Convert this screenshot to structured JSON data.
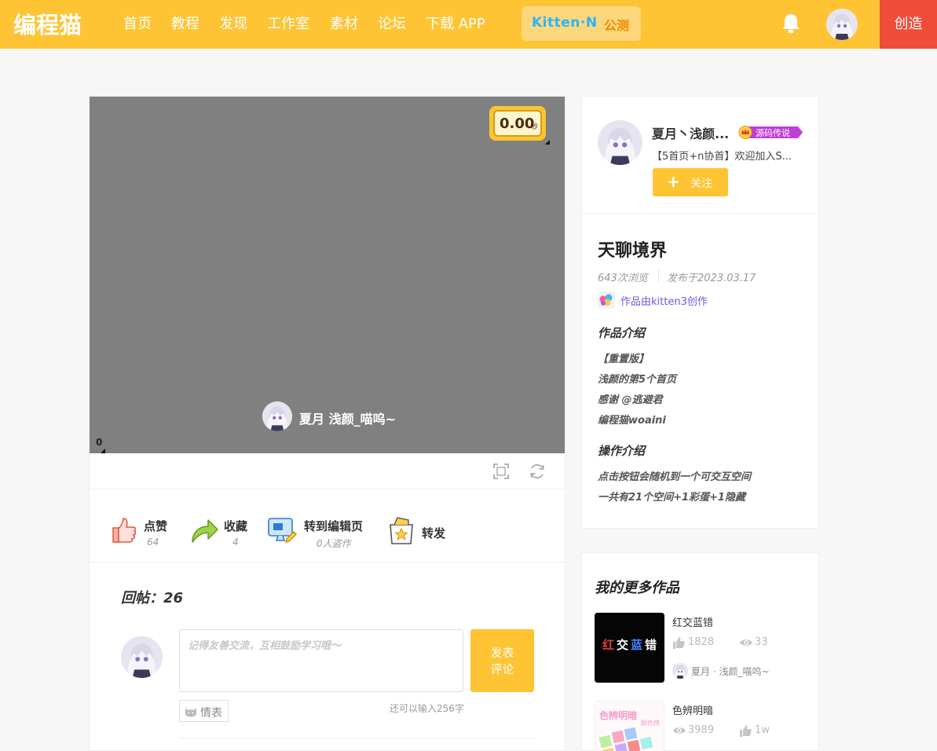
{
  "nav": {
    "logo_text": "编程猫",
    "items": [
      "首页",
      "教程",
      "发现",
      "工作室",
      "素材",
      "论坛",
      "下载 APP"
    ],
    "kitten_badge": "Kitten·N",
    "kitten_badge_sub": "公测",
    "create_label": "创造"
  },
  "stage": {
    "timer_value": "0.00",
    "timer_unit": "秒",
    "zero_label": "0",
    "author_name": "夏月 浅颜_喵呜~"
  },
  "actions": {
    "like_label": "点赞",
    "like_count": "64",
    "collect_label": "收藏",
    "collect_count": "4",
    "edit_label": "转到编辑页",
    "edit_sub": "0人盗作",
    "share_label": "转发"
  },
  "comments": {
    "reply_title": "回帖：26",
    "placeholder": "记得友善交流，互相鼓励学习哦～",
    "post_label_1": "发表",
    "post_label_2": "评论",
    "emoji_label": "情表",
    "char_count": "还可以输入256字"
  },
  "author": {
    "name": "夏月丶浅颜...",
    "tag": "源码传说",
    "desc": "【5首页+n协首】欢迎加入S...",
    "follow_label": "关注"
  },
  "work": {
    "title": "天聊境界",
    "views": "643次浏览",
    "published": "发布于2023.03.17",
    "made_by": "作品由kitten3创作",
    "intro_heading": "作品介绍",
    "intro_lines": [
      "【重置版】",
      "浅颜的第5个首页",
      "感谢 @逃避君",
      "编程猫woaini"
    ],
    "ops_heading": "操作介绍",
    "ops_lines": [
      "点击按钮会随机到一个可交互空间",
      "一共有21个空间+1彩蛋+1隐藏"
    ]
  },
  "more_works": {
    "title": "我的更多作品",
    "items": [
      {
        "title": "红交蓝错",
        "likes": "1828",
        "views": "33",
        "author": "夏月 · 浅颜_喵呜~"
      },
      {
        "title": "色辨明暗",
        "views": "3989",
        "likes": "1w"
      }
    ]
  },
  "colors": {
    "brand_yellow": "#fec433",
    "create_red": "#f04c3a",
    "kitten_blue": "#2ab3ff",
    "link_purple": "#6a5bdc"
  }
}
